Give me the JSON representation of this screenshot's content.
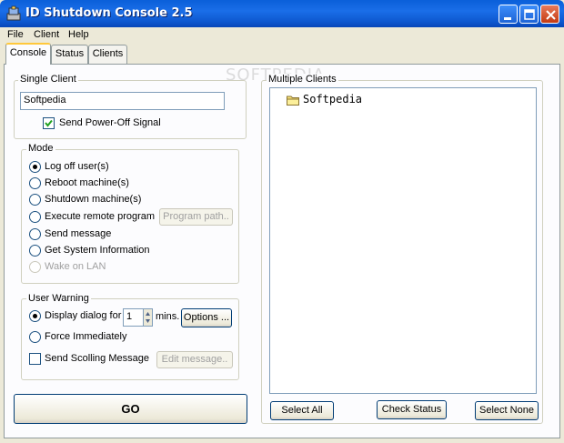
{
  "window": {
    "title": "ID Shutdown Console 2.5",
    "controls": {
      "minimize_icon": "minimize-icon",
      "maximize_icon": "maximize-icon",
      "close_icon": "close-icon"
    }
  },
  "menu": [
    "File",
    "Client",
    "Help"
  ],
  "tabs": [
    {
      "label": "Console",
      "active": true
    },
    {
      "label": "Status",
      "active": false
    },
    {
      "label": "Clients",
      "active": false
    }
  ],
  "watermark": "SOFTPEDIA",
  "single_client": {
    "legend": "Single Client",
    "value": "Softpedia",
    "power_off": {
      "label": "Send Power-Off Signal",
      "checked": true
    }
  },
  "mode": {
    "legend": "Mode",
    "options": [
      {
        "label": "Log off user(s)",
        "selected": true,
        "enabled": true
      },
      {
        "label": "Reboot machine(s)",
        "selected": false,
        "enabled": true
      },
      {
        "label": "Shutdown machine(s)",
        "selected": false,
        "enabled": true
      },
      {
        "label": "Execute remote program",
        "selected": false,
        "enabled": true
      },
      {
        "label": "Send message",
        "selected": false,
        "enabled": true
      },
      {
        "label": "Get System Information",
        "selected": false,
        "enabled": true
      },
      {
        "label": "Wake on LAN",
        "selected": false,
        "enabled": false
      }
    ],
    "program_path_button": "Program path.."
  },
  "user_warning": {
    "legend": "User Warning",
    "display_dialog": {
      "label": "Display dialog for",
      "selected": true
    },
    "minutes_value": "1",
    "minutes_unit": "mins.",
    "options_button": "Options ...",
    "force_immediately": {
      "label": "Force Immediately",
      "selected": false
    },
    "scrolling_message": {
      "label": "Send Scolling Message",
      "checked": false
    },
    "edit_message_button": "Edit message.."
  },
  "go_button": "GO",
  "multiple_clients": {
    "legend": "Multiple Clients",
    "items": [
      {
        "label": "Softpedia",
        "icon": "folder-icon"
      }
    ],
    "select_all": "Select All",
    "check_status": "Check Status",
    "select_none": "Select None"
  }
}
